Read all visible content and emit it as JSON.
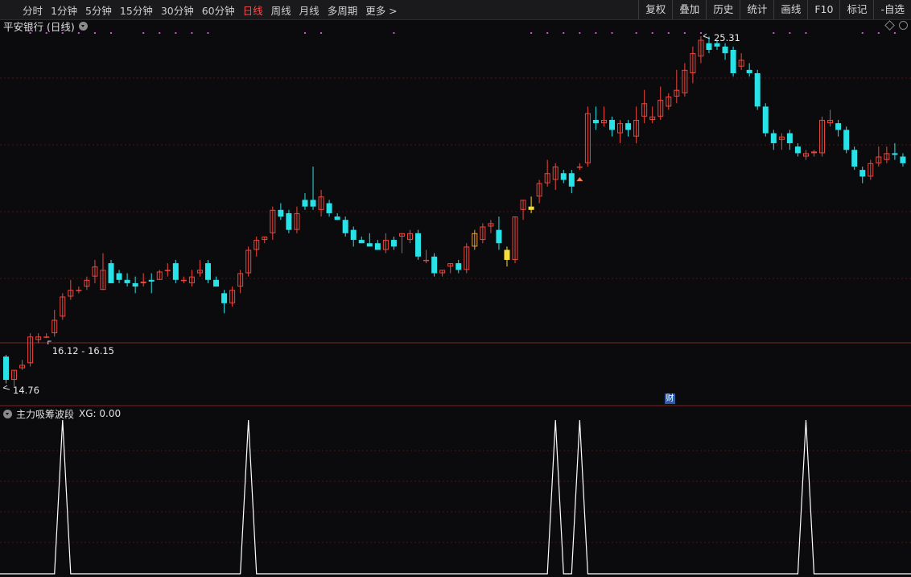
{
  "toolbar": {
    "periods": [
      "分时",
      "1分钟",
      "5分钟",
      "15分钟",
      "30分钟",
      "60分钟",
      "日线",
      "周线",
      "月线",
      "多周期",
      "更多 >"
    ],
    "active_period": "日线",
    "right_tools": [
      "复权",
      "叠加",
      "历史",
      "统计",
      "画线",
      "F10",
      "标记",
      "-自选"
    ]
  },
  "chart": {
    "title": "平安银行 (日线)",
    "high_label": "25.31",
    "low_label": "14.76",
    "range_label": "16.12 - 16.15",
    "finance_badge": "财"
  },
  "indicator": {
    "name": "主力吸筹波段",
    "xg_label": "XG: 0.00"
  },
  "colors": {
    "up": "#f0463c",
    "down": "#27e3e8",
    "signal": "#f2a23a",
    "grid": "#4a1414",
    "background": "#0b0b0d",
    "indicator_line": "#ffffff"
  },
  "chart_data": {
    "type": "candlestick",
    "price_range": [
      14.76,
      25.31
    ],
    "candles": [
      {
        "o": 15.7,
        "h": 15.75,
        "l": 14.9,
        "c": 15.0
      },
      {
        "o": 15.0,
        "h": 15.3,
        "l": 14.8,
        "c": 15.3
      },
      {
        "o": 15.35,
        "h": 15.6,
        "l": 15.3,
        "c": 15.45
      },
      {
        "o": 15.5,
        "h": 16.4,
        "l": 15.4,
        "c": 16.3
      },
      {
        "o": 16.2,
        "h": 16.4,
        "l": 16.1,
        "c": 16.3
      },
      {
        "o": 16.3,
        "h": 16.4,
        "l": 16.25,
        "c": 16.3
      },
      {
        "o": 16.4,
        "h": 17.1,
        "l": 16.3,
        "c": 16.8
      },
      {
        "o": 16.9,
        "h": 17.6,
        "l": 16.8,
        "c": 17.5
      },
      {
        "o": 17.5,
        "h": 18.0,
        "l": 17.4,
        "c": 17.7
      },
      {
        "o": 17.7,
        "h": 17.8,
        "l": 17.6,
        "c": 17.7
      },
      {
        "o": 17.8,
        "h": 18.1,
        "l": 17.7,
        "c": 18.0
      },
      {
        "o": 18.1,
        "h": 18.6,
        "l": 17.9,
        "c": 18.4
      },
      {
        "o": 17.7,
        "h": 18.8,
        "l": 17.7,
        "c": 18.3
      },
      {
        "o": 18.5,
        "h": 18.6,
        "l": 17.9,
        "c": 17.9
      },
      {
        "o": 18.2,
        "h": 18.3,
        "l": 17.9,
        "c": 18.0
      },
      {
        "o": 18.0,
        "h": 18.2,
        "l": 17.8,
        "c": 17.9
      },
      {
        "o": 17.9,
        "h": 18.1,
        "l": 17.6,
        "c": 17.8
      },
      {
        "o": 17.9,
        "h": 18.2,
        "l": 17.8,
        "c": 17.95
      },
      {
        "o": 18.0,
        "h": 18.2,
        "l": 17.6,
        "c": 17.95
      },
      {
        "o": 18.0,
        "h": 18.3,
        "l": 18.0,
        "c": 18.25
      },
      {
        "o": 18.3,
        "h": 18.5,
        "l": 18.1,
        "c": 18.3
      },
      {
        "o": 18.5,
        "h": 18.6,
        "l": 17.9,
        "c": 18.0
      },
      {
        "o": 18.0,
        "h": 18.1,
        "l": 17.9,
        "c": 18.0
      },
      {
        "o": 17.9,
        "h": 18.3,
        "l": 17.8,
        "c": 18.1
      },
      {
        "o": 18.2,
        "h": 18.6,
        "l": 18.1,
        "c": 18.3
      },
      {
        "o": 18.5,
        "h": 18.6,
        "l": 17.9,
        "c": 18.0
      },
      {
        "o": 18.0,
        "h": 18.1,
        "l": 17.8,
        "c": 17.8
      },
      {
        "o": 17.6,
        "h": 17.7,
        "l": 17.0,
        "c": 17.3
      },
      {
        "o": 17.3,
        "h": 17.8,
        "l": 17.2,
        "c": 17.7
      },
      {
        "o": 17.8,
        "h": 18.3,
        "l": 17.6,
        "c": 18.2
      },
      {
        "o": 18.2,
        "h": 19.0,
        "l": 18.1,
        "c": 18.9
      },
      {
        "o": 18.9,
        "h": 19.3,
        "l": 18.7,
        "c": 19.2
      },
      {
        "o": 19.2,
        "h": 19.3,
        "l": 19.1,
        "c": 19.3
      },
      {
        "o": 19.4,
        "h": 20.2,
        "l": 19.2,
        "c": 20.1
      },
      {
        "o": 20.1,
        "h": 20.3,
        "l": 19.8,
        "c": 19.9
      },
      {
        "o": 20.0,
        "h": 20.1,
        "l": 19.4,
        "c": 19.5
      },
      {
        "o": 19.5,
        "h": 20.2,
        "l": 19.4,
        "c": 20.0
      },
      {
        "o": 20.4,
        "h": 20.6,
        "l": 20.1,
        "c": 20.2
      },
      {
        "o": 20.4,
        "h": 21.4,
        "l": 20.1,
        "c": 20.2
      },
      {
        "o": 20.1,
        "h": 20.7,
        "l": 19.9,
        "c": 20.5
      },
      {
        "o": 20.3,
        "h": 20.4,
        "l": 19.9,
        "c": 20.0
      },
      {
        "o": 19.9,
        "h": 20.0,
        "l": 19.8,
        "c": 19.8
      },
      {
        "o": 19.8,
        "h": 19.9,
        "l": 19.3,
        "c": 19.4
      },
      {
        "o": 19.5,
        "h": 19.6,
        "l": 19.0,
        "c": 19.2
      },
      {
        "o": 19.2,
        "h": 19.3,
        "l": 19.1,
        "c": 19.1
      },
      {
        "o": 19.1,
        "h": 19.4,
        "l": 19.0,
        "c": 19.0
      },
      {
        "o": 19.1,
        "h": 19.2,
        "l": 18.9,
        "c": 18.9
      },
      {
        "o": 18.9,
        "h": 19.4,
        "l": 18.8,
        "c": 19.2
      },
      {
        "o": 19.2,
        "h": 19.3,
        "l": 18.9,
        "c": 19.0
      },
      {
        "o": 19.3,
        "h": 19.4,
        "l": 18.8,
        "c": 19.4
      },
      {
        "o": 19.2,
        "h": 19.5,
        "l": 19.1,
        "c": 19.4
      },
      {
        "o": 19.4,
        "h": 19.5,
        "l": 18.6,
        "c": 18.7
      },
      {
        "o": 18.6,
        "h": 18.9,
        "l": 18.5,
        "c": 18.6
      },
      {
        "o": 18.7,
        "h": 18.8,
        "l": 18.1,
        "c": 18.2
      },
      {
        "o": 18.2,
        "h": 18.3,
        "l": 18.1,
        "c": 18.3
      },
      {
        "o": 18.4,
        "h": 18.5,
        "l": 18.2,
        "c": 18.5
      },
      {
        "o": 18.5,
        "h": 18.6,
        "l": 18.2,
        "c": 18.3
      },
      {
        "o": 18.3,
        "h": 19.1,
        "l": 18.2,
        "c": 19.0
      },
      {
        "o": 19.0,
        "h": 19.5,
        "l": 18.9,
        "c": 19.4
      },
      {
        "o": 19.2,
        "h": 19.7,
        "l": 19.1,
        "c": 19.6
      },
      {
        "o": 19.6,
        "h": 19.8,
        "l": 19.4,
        "c": 19.7
      },
      {
        "o": 19.5,
        "h": 19.9,
        "l": 18.9,
        "c": 19.1
      },
      {
        "o": 18.9,
        "h": 19.0,
        "l": 18.4,
        "c": 18.6
      },
      {
        "o": 18.6,
        "h": 19.9,
        "l": 18.5,
        "c": 19.9
      },
      {
        "o": 20.1,
        "h": 20.4,
        "l": 19.8,
        "c": 20.4
      },
      {
        "o": 20.2,
        "h": 20.5,
        "l": 20.0,
        "c": 20.1
      },
      {
        "o": 20.5,
        "h": 21.0,
        "l": 20.3,
        "c": 20.9
      },
      {
        "o": 20.9,
        "h": 21.6,
        "l": 20.8,
        "c": 21.2
      },
      {
        "o": 21.0,
        "h": 21.5,
        "l": 20.7,
        "c": 21.4
      },
      {
        "o": 21.2,
        "h": 21.3,
        "l": 20.9,
        "c": 21.0
      },
      {
        "o": 21.2,
        "h": 21.3,
        "l": 20.6,
        "c": 20.8
      },
      {
        "o": 21.4,
        "h": 21.5,
        "l": 21.3,
        "c": 21.4
      },
      {
        "o": 21.5,
        "h": 23.2,
        "l": 21.4,
        "c": 23.0
      },
      {
        "o": 22.8,
        "h": 23.2,
        "l": 22.5,
        "c": 22.7
      },
      {
        "o": 22.7,
        "h": 23.2,
        "l": 22.6,
        "c": 22.8
      },
      {
        "o": 22.8,
        "h": 22.9,
        "l": 22.3,
        "c": 22.5
      },
      {
        "o": 22.4,
        "h": 22.8,
        "l": 22.1,
        "c": 22.7
      },
      {
        "o": 22.7,
        "h": 22.8,
        "l": 22.3,
        "c": 22.5
      },
      {
        "o": 22.3,
        "h": 23.2,
        "l": 22.1,
        "c": 22.8
      },
      {
        "o": 22.9,
        "h": 23.7,
        "l": 22.7,
        "c": 23.3
      },
      {
        "o": 22.8,
        "h": 23.2,
        "l": 22.7,
        "c": 22.9
      },
      {
        "o": 22.9,
        "h": 23.8,
        "l": 22.8,
        "c": 23.4
      },
      {
        "o": 23.2,
        "h": 23.6,
        "l": 23.1,
        "c": 23.5
      },
      {
        "o": 23.5,
        "h": 24.3,
        "l": 23.3,
        "c": 23.7
      },
      {
        "o": 23.6,
        "h": 24.5,
        "l": 23.5,
        "c": 24.3
      },
      {
        "o": 24.2,
        "h": 25.0,
        "l": 23.9,
        "c": 24.8
      },
      {
        "o": 24.7,
        "h": 25.31,
        "l": 24.5,
        "c": 25.2
      },
      {
        "o": 25.1,
        "h": 25.3,
        "l": 24.8,
        "c": 24.9
      },
      {
        "o": 25.1,
        "h": 25.2,
        "l": 24.9,
        "c": 25.0
      },
      {
        "o": 25.0,
        "h": 25.1,
        "l": 24.6,
        "c": 24.8
      },
      {
        "o": 24.9,
        "h": 25.0,
        "l": 24.1,
        "c": 24.2
      },
      {
        "o": 24.4,
        "h": 24.8,
        "l": 24.3,
        "c": 24.6
      },
      {
        "o": 24.3,
        "h": 24.5,
        "l": 24.1,
        "c": 24.2
      },
      {
        "o": 24.2,
        "h": 24.3,
        "l": 23.1,
        "c": 23.2
      },
      {
        "o": 23.2,
        "h": 23.3,
        "l": 22.3,
        "c": 22.4
      },
      {
        "o": 22.4,
        "h": 22.5,
        "l": 21.9,
        "c": 22.1
      },
      {
        "o": 22.2,
        "h": 22.4,
        "l": 21.9,
        "c": 22.3
      },
      {
        "o": 22.4,
        "h": 22.5,
        "l": 21.9,
        "c": 22.1
      },
      {
        "o": 22.0,
        "h": 22.1,
        "l": 21.7,
        "c": 21.8
      },
      {
        "o": 21.7,
        "h": 21.9,
        "l": 21.6,
        "c": 21.8
      },
      {
        "o": 21.8,
        "h": 21.9,
        "l": 21.7,
        "c": 21.85
      },
      {
        "o": 21.8,
        "h": 22.9,
        "l": 21.7,
        "c": 22.8
      },
      {
        "o": 22.7,
        "h": 23.1,
        "l": 22.6,
        "c": 22.8
      },
      {
        "o": 22.7,
        "h": 22.8,
        "l": 22.3,
        "c": 22.5
      },
      {
        "o": 22.5,
        "h": 22.6,
        "l": 21.8,
        "c": 21.9
      },
      {
        "o": 21.9,
        "h": 22.0,
        "l": 21.3,
        "c": 21.4
      },
      {
        "o": 21.3,
        "h": 21.4,
        "l": 20.9,
        "c": 21.1
      },
      {
        "o": 21.1,
        "h": 21.6,
        "l": 21.0,
        "c": 21.5
      },
      {
        "o": 21.5,
        "h": 22.0,
        "l": 21.4,
        "c": 21.7
      },
      {
        "o": 21.6,
        "h": 22.0,
        "l": 21.5,
        "c": 21.8
      },
      {
        "o": 21.8,
        "h": 22.1,
        "l": 21.6,
        "c": 21.75
      },
      {
        "o": 21.7,
        "h": 21.8,
        "l": 21.4,
        "c": 21.5
      }
    ],
    "signal_candles": [
      58,
      62,
      65
    ],
    "signal_arrow_candle": 71,
    "indicator_xg_spikes": [
      7,
      30,
      68,
      71,
      99
    ],
    "indicator_range": [
      0,
      1
    ]
  }
}
